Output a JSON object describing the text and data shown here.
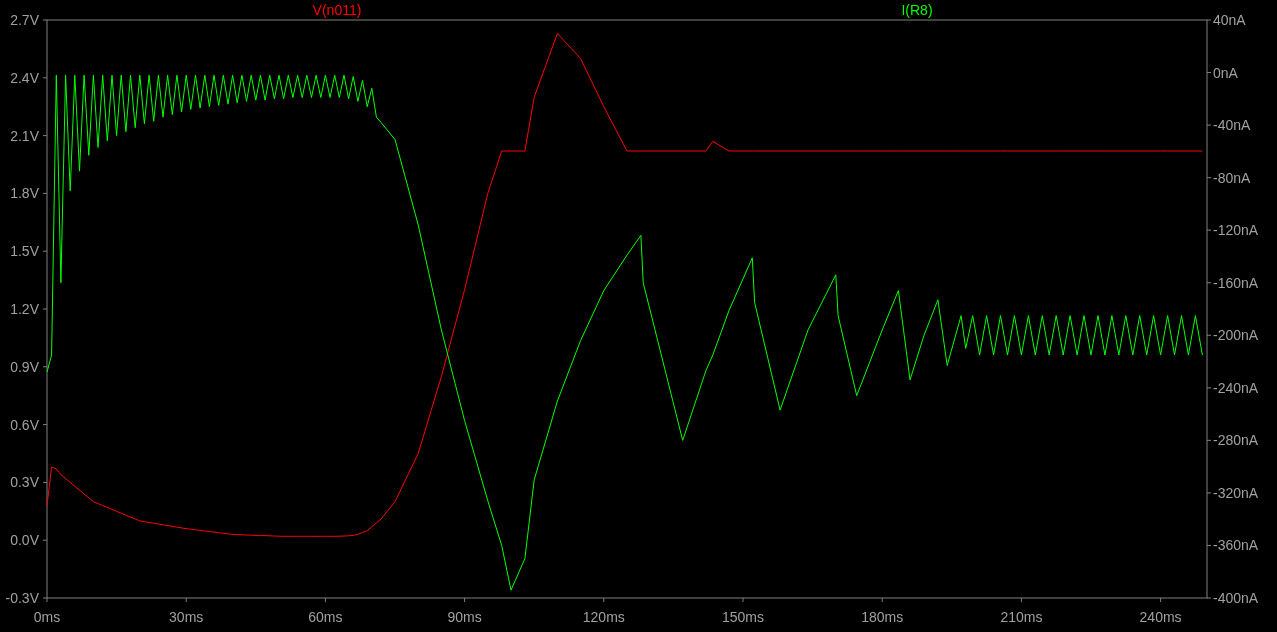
{
  "chart_data": {
    "type": "line",
    "xlim": [
      0,
      250
    ],
    "ylim": [
      -0.3,
      2.7
    ],
    "y2lim": [
      -400,
      40
    ],
    "xticks": [
      {
        "value": 0,
        "label": "0ms"
      },
      {
        "value": 30,
        "label": "30ms"
      },
      {
        "value": 60,
        "label": "60ms"
      },
      {
        "value": 90,
        "label": "90ms"
      },
      {
        "value": 120,
        "label": "120ms"
      },
      {
        "value": 150,
        "label": "150ms"
      },
      {
        "value": 180,
        "label": "180ms"
      },
      {
        "value": 210,
        "label": "210ms"
      },
      {
        "value": 240,
        "label": "240ms"
      }
    ],
    "yticks": [
      {
        "value": 2.7,
        "label": "2.7V"
      },
      {
        "value": 2.4,
        "label": "2.4V"
      },
      {
        "value": 2.1,
        "label": "2.1V"
      },
      {
        "value": 1.8,
        "label": "1.8V"
      },
      {
        "value": 1.5,
        "label": "1.5V"
      },
      {
        "value": 1.2,
        "label": "1.2V"
      },
      {
        "value": 0.9,
        "label": "0.9V"
      },
      {
        "value": 0.6,
        "label": "0.6V"
      },
      {
        "value": 0.3,
        "label": "0.3V"
      },
      {
        "value": 0,
        "label": "0.0V"
      },
      {
        "value": -0.3,
        "label": "-0.3V"
      }
    ],
    "y2ticks": [
      {
        "value": 40,
        "label": "40nA"
      },
      {
        "value": 0,
        "label": "0nA"
      },
      {
        "value": -40,
        "label": "-40nA"
      },
      {
        "value": -80,
        "label": "-80nA"
      },
      {
        "value": -120,
        "label": "-120nA"
      },
      {
        "value": -160,
        "label": "-160nA"
      },
      {
        "value": -200,
        "label": "-200nA"
      },
      {
        "value": -240,
        "label": "-240nA"
      },
      {
        "value": -280,
        "label": "-280nA"
      },
      {
        "value": -320,
        "label": "-320nA"
      },
      {
        "value": -360,
        "label": "-360nA"
      },
      {
        "value": -400,
        "label": "-400nA"
      }
    ],
    "x": [
      0,
      1,
      2,
      3,
      4,
      5,
      6,
      7,
      8,
      9,
      10,
      11,
      12,
      13,
      14,
      15,
      16,
      17,
      18,
      19,
      20,
      21,
      22,
      23,
      24,
      25,
      26,
      27,
      28,
      29,
      30,
      31,
      32,
      33,
      34,
      35,
      36,
      37,
      38,
      39,
      40,
      41,
      42,
      43,
      44,
      45,
      46,
      47,
      48,
      49,
      50,
      51,
      52,
      53,
      54,
      55,
      56,
      57,
      58,
      59,
      60,
      61,
      62,
      63,
      64,
      65,
      66,
      67,
      68,
      69,
      70,
      71,
      72,
      75,
      80,
      85,
      90,
      95,
      98,
      100,
      103,
      105,
      110,
      115,
      120,
      125,
      128,
      128.5,
      137,
      142,
      143.5,
      147,
      152,
      152.5,
      158,
      164,
      170,
      170.5,
      174.5,
      180,
      183.5,
      184,
      186,
      189,
      192,
      194,
      197,
      198,
      199.5,
      201,
      202.5,
      204,
      205.5,
      207,
      208.5,
      210,
      211.5,
      213,
      214.5,
      216,
      217.5,
      219,
      220.5,
      222,
      223.5,
      225,
      226.5,
      228,
      229.5,
      231,
      232.5,
      234,
      235.5,
      237,
      238.5,
      240,
      241.5,
      243,
      244.5,
      246,
      247.5,
      249
    ],
    "series": [
      {
        "name": "V(n011)",
        "color": "#ff0000",
        "axis": "y",
        "values": [
          0.18,
          0.38,
          0.37,
          0.34,
          0.32,
          0.3,
          0.28,
          0.26,
          0.24,
          0.22,
          0.2,
          0.19,
          0.18,
          0.17,
          0.16,
          0.15,
          0.14,
          0.13,
          0.12,
          0.11,
          0.1,
          0.096,
          0.092,
          0.088,
          0.084,
          0.08,
          0.076,
          0.072,
          0.068,
          0.064,
          0.06,
          0.057,
          0.054,
          0.051,
          0.048,
          0.045,
          0.042,
          0.039,
          0.036,
          0.033,
          0.03,
          0.029,
          0.028,
          0.027,
          0.026,
          0.025,
          0.025,
          0.024,
          0.023,
          0.022,
          0.021,
          0.02,
          0.02,
          0.02,
          0.02,
          0.02,
          0.02,
          0.02,
          0.02,
          0.02,
          0.02,
          0.02,
          0.02,
          0.021,
          0.022,
          0.023,
          0.025,
          0.03,
          0.04,
          0.05,
          0.07,
          0.09,
          0.11,
          0.2,
          0.45,
          0.85,
          1.3,
          1.8,
          2.02,
          2.02,
          2.02,
          2.3,
          2.63,
          2.5,
          2.25,
          2.02,
          2.02,
          2.02,
          2.02,
          2.02,
          2.07,
          2.02,
          2.02,
          2.02,
          2.02,
          2.02,
          2.02,
          2.02,
          2.02,
          2.02,
          2.02,
          2.02,
          2.02,
          2.02,
          2.02,
          2.02,
          2.02,
          2.02,
          2.02,
          2.02,
          2.02,
          2.02,
          2.02,
          2.02,
          2.02,
          2.02,
          2.02,
          2.02,
          2.02,
          2.02,
          2.02,
          2.02,
          2.02,
          2.02,
          2.02,
          2.02,
          2.02,
          2.02,
          2.02,
          2.02,
          2.02,
          2.02,
          2.02,
          2.02,
          2.02,
          2.02,
          2.02,
          2.02,
          2.02,
          2.02,
          2.02,
          2.02
        ]
      },
      {
        "name": "I(R8)",
        "color": "#00ff00",
        "axis": "y2",
        "values": [
          -228,
          -215,
          -2,
          -160,
          -2,
          -90,
          -2,
          -75,
          -2,
          -63,
          -2,
          -57,
          -2,
          -52,
          -2,
          -48,
          -2,
          -45,
          -2,
          -42,
          -2,
          -39,
          -2,
          -37,
          -2,
          -34,
          -2,
          -32,
          -2,
          -30,
          -2,
          -28,
          -2,
          -27,
          -2,
          -26,
          -2,
          -25,
          -2,
          -24,
          -2,
          -23,
          -2,
          -22,
          -2,
          -21,
          -2,
          -21,
          -2,
          -20,
          -2,
          -20,
          -2,
          -19,
          -2,
          -19,
          -2,
          -19,
          -2,
          -19,
          -2,
          -19,
          -2,
          -19,
          -2,
          -20,
          -3,
          -22,
          -6,
          -26,
          -12,
          -34,
          -38,
          -51,
          -116,
          -196,
          -265,
          -326,
          -360,
          -394,
          -370,
          -310,
          -250,
          -204,
          -166,
          -139,
          -124,
          -160,
          -280,
          -227,
          -215,
          -181,
          -141,
          -175,
          -257,
          -196,
          -154,
          -185,
          -246,
          -196,
          -166,
          -180,
          -234,
          -200,
          -173,
          -223,
          -185,
          -210,
          -185,
          -215,
          -185,
          -215,
          -185,
          -215,
          -185,
          -215,
          -185,
          -215,
          -185,
          -215,
          -185,
          -215,
          -185,
          -215,
          -185,
          -215,
          -185,
          -215,
          -185,
          -215,
          -185,
          -215,
          -185,
          -215,
          -185,
          -215,
          -185,
          -215,
          -185,
          -215,
          -185,
          -215
        ]
      }
    ]
  }
}
